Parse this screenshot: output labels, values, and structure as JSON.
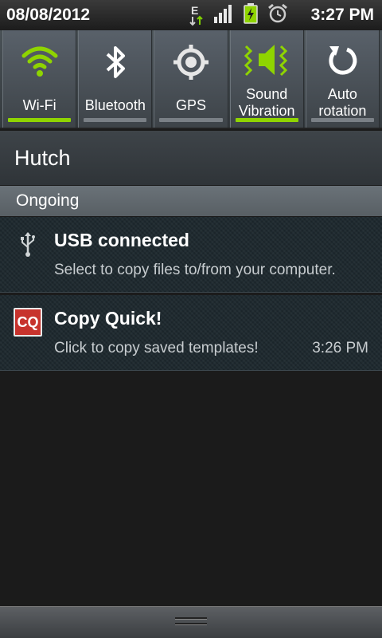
{
  "status_bar": {
    "date": "08/08/2012",
    "time": "3:27 PM",
    "network_type": "E",
    "icons": [
      "data-e-icon",
      "signal-icon",
      "battery-charging-icon",
      "alarm-icon"
    ]
  },
  "toggles": [
    {
      "label": "Wi-Fi",
      "icon": "wifi-icon",
      "on": true
    },
    {
      "label": "Bluetooth",
      "icon": "bluetooth-icon",
      "on": false
    },
    {
      "label": "GPS",
      "icon": "gps-icon",
      "on": false
    },
    {
      "label_line1": "Sound",
      "label_line2": "Vibration",
      "icon": "sound-vibration-icon",
      "on": true
    },
    {
      "label_line1": "Auto",
      "label_line2": "rotation",
      "icon": "auto-rotation-icon",
      "on": false
    }
  ],
  "carrier": "Hutch",
  "section_header": "Ongoing",
  "notifications": [
    {
      "title": "USB connected",
      "text": "Select to copy files to/from your computer.",
      "icon": "usb-icon"
    },
    {
      "title": "Copy Quick!",
      "text": "Click to copy saved templates!",
      "time": "3:26 PM",
      "icon_text": "CQ",
      "icon": "copy-quick-app-icon"
    }
  ],
  "colors": {
    "accent_on": "#8fd400",
    "cq_icon_bg": "#c7332d"
  }
}
